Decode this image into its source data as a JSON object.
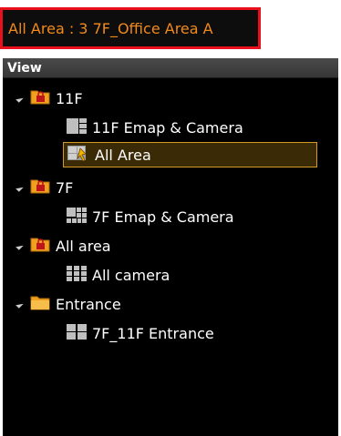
{
  "header": {
    "title": "All Area : 3 7F_Office Area A"
  },
  "panel": {
    "view_label": "View"
  },
  "tree": {
    "group_11f": {
      "label": "11F"
    },
    "item_11f_emap": {
      "label": "11F Emap & Camera"
    },
    "item_all_area": {
      "label": "All Area"
    },
    "group_7f": {
      "label": "7F"
    },
    "item_7f_emap": {
      "label": "7F Emap & Camera"
    },
    "group_all_area": {
      "label": "All area"
    },
    "item_all_camera": {
      "label": "All camera"
    },
    "group_entrance": {
      "label": "Entrance"
    },
    "item_entrance": {
      "label": "7F_11F Entrance"
    }
  },
  "colors": {
    "title_text": "#f28a1a",
    "title_border": "#e8101c",
    "selection_border": "#d49a2a",
    "folder": "#f0a020",
    "lock": "#c0141c"
  }
}
